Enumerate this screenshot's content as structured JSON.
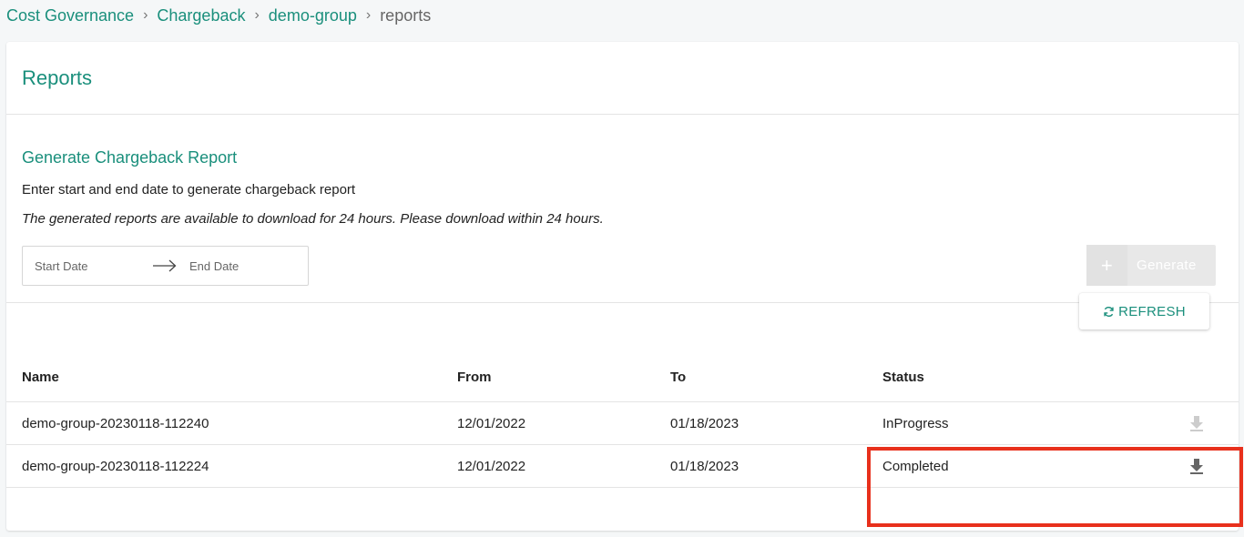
{
  "breadcrumb": {
    "items": [
      "Cost Governance",
      "Chargeback",
      "demo-group"
    ],
    "current": "reports",
    "separator": "›"
  },
  "page": {
    "title": "Reports"
  },
  "generate": {
    "title": "Generate Chargeback Report",
    "description": "Enter start and end date to generate chargeback report",
    "note": "The generated reports are available to download for 24 hours. Please download within 24 hours.",
    "start_placeholder": "Start Date",
    "end_placeholder": "End Date",
    "button_icon": "+",
    "button_label": "Generate",
    "button_disabled": true
  },
  "refresh": {
    "label": "REFRESH",
    "icon": "refresh-icon"
  },
  "table": {
    "columns": [
      "Name",
      "From",
      "To",
      "Status"
    ],
    "rows": [
      {
        "name": "demo-group-20230118-112240",
        "from": "12/01/2022",
        "to": "01/18/2023",
        "status": "InProgress",
        "download_enabled": false
      },
      {
        "name": "demo-group-20230118-112224",
        "from": "12/01/2022",
        "to": "01/18/2023",
        "status": "Completed",
        "download_enabled": true
      }
    ]
  },
  "colors": {
    "accent": "#1a8f7c",
    "highlight": "#e8301c",
    "disabled_button": "#e8e8e8",
    "download_enabled": "#666666",
    "download_disabled": "#cccccc"
  }
}
